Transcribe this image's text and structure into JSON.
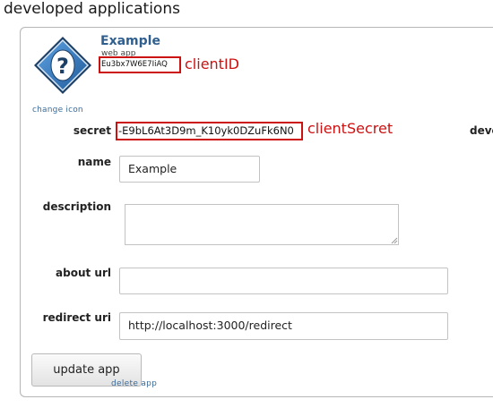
{
  "section": {
    "title": "developed applications"
  },
  "app": {
    "name": "Example",
    "type": "web app",
    "change_icon": "change icon",
    "client_id": "Eu3bx7W6E7IiAQ",
    "client_id_annotation": "clientID",
    "icon": "question-mark-icon"
  },
  "form": {
    "secret_label": "secret",
    "secret_value": "-E9bL6At3D9m_K10yk0DZuFk6N0",
    "secret_annotation": "clientSecret",
    "developer_label": "devel",
    "name_label": "name",
    "name_value": "Example",
    "description_label": "description",
    "description_value": "",
    "about_url_label": "about url",
    "about_url_value": "",
    "redirect_uri_label": "redirect uri",
    "redirect_uri_value": "http://localhost:3000/redirect"
  },
  "actions": {
    "update_label": "update app",
    "delete_label": "delete app"
  },
  "colors": {
    "annotation": "#cc1111",
    "link": "#3a6b9b",
    "icon_fill": "#2e6fb0"
  }
}
